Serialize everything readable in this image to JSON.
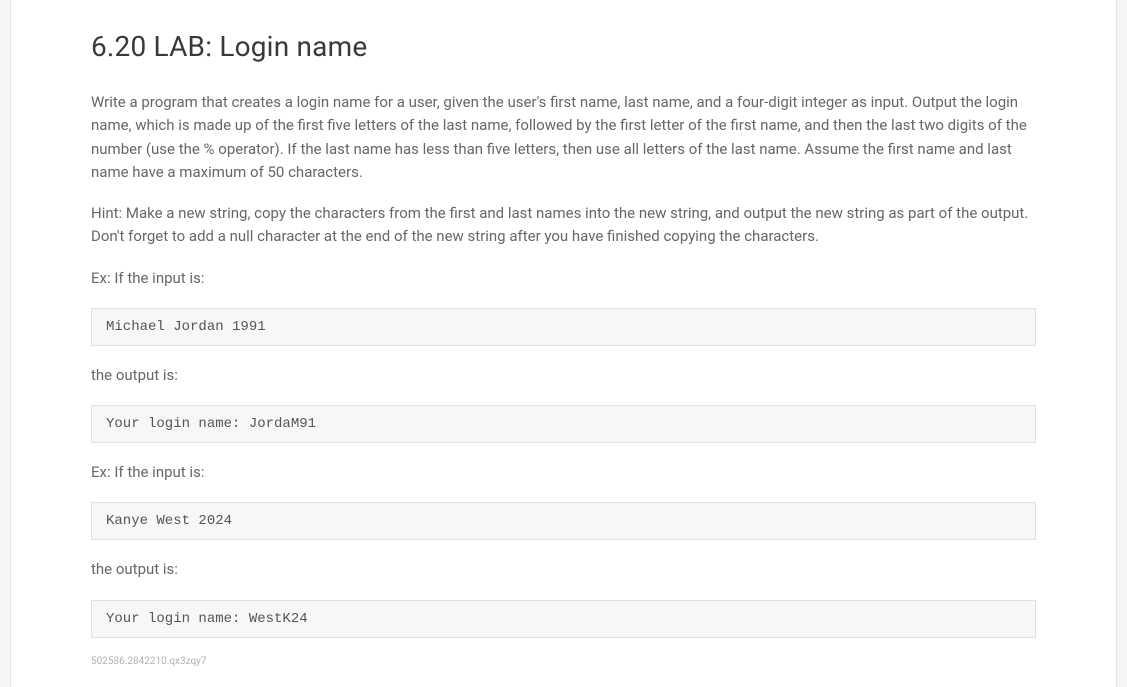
{
  "title": "6.20 LAB: Login name",
  "paragraphs": {
    "p1": "Write a program that creates a login name for a user, given the user's first name, last name, and a four-digit integer as input. Output the login name, which is made up of the first five letters of the last name, followed by the first letter of the first name, and then the last two digits of the number (use the % operator). If the last name has less than five letters, then use all letters of the last name. Assume the first name and last name have a maximum of 50 characters.",
    "p2": "Hint: Make a new string, copy the characters from the first and last names into the new string, and output the new string as part of the output. Don't forget to add a null character at the end of the new string after you have finished copying the characters.",
    "ex1_intro": "Ex: If the input is:",
    "ex1_input": "Michael Jordan 1991",
    "ex1_output_label": "the output is:",
    "ex1_output": "Your login name: JordaM91",
    "ex2_intro": "Ex: If the input is:",
    "ex2_input": "Kanye West 2024",
    "ex2_output_label": "the output is:",
    "ex2_output": "Your login name: WestK24"
  },
  "footer_id": "502586.2842210.qx3zqy7"
}
